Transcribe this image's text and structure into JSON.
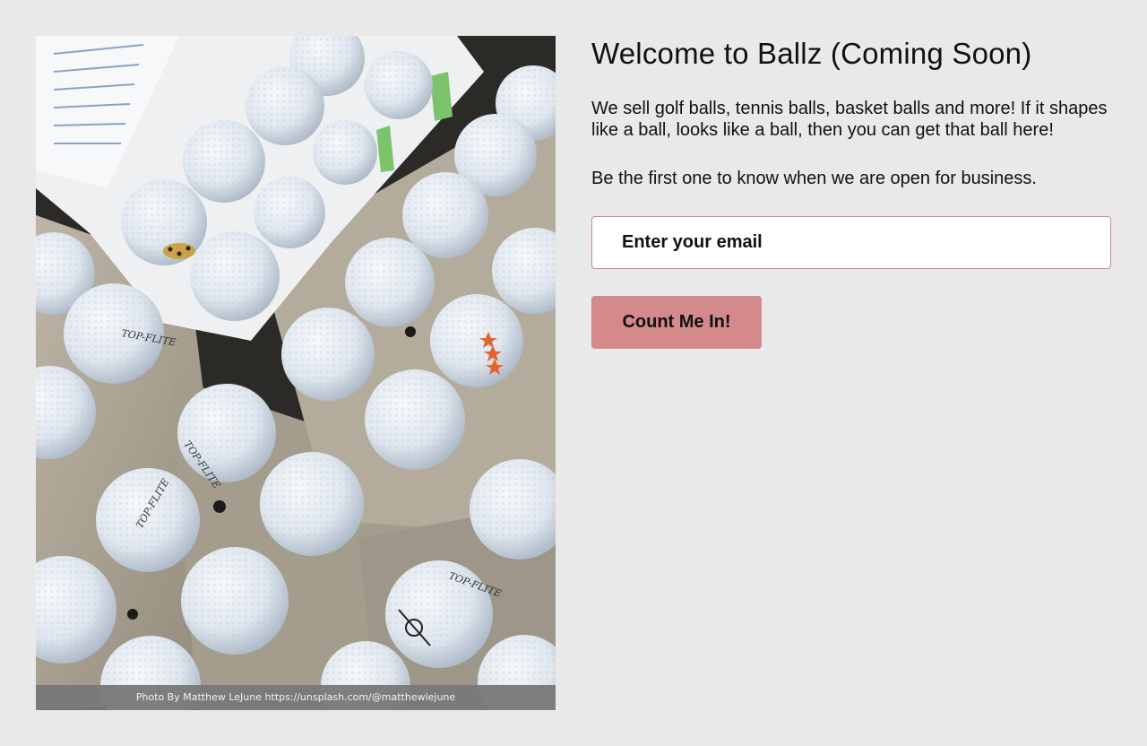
{
  "hero_image": {
    "alt": "Golf balls in egg cartons",
    "caption": "Photo By Matthew LeJune https://unsplash.com/@matthewlejune"
  },
  "page": {
    "title": "Welcome to Ballz (Coming Soon)",
    "intro": "We sell golf balls, tennis balls, basket balls and more! If it shapes like a ball, looks like a ball, then you can get that ball here!",
    "cta_text": "Be the first one to know when we are open for business."
  },
  "signup": {
    "email_placeholder": "Enter your email",
    "email_value": "",
    "submit_label": "Count Me In!"
  },
  "colors": {
    "background": "#e9e9e9",
    "button": "#d4898b",
    "input_border": "#c98b8b"
  }
}
